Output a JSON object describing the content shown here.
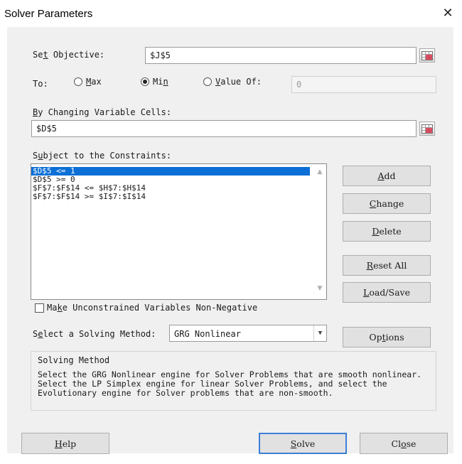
{
  "window": {
    "title": "Solver Parameters",
    "close_glyph": "✕"
  },
  "objective": {
    "label_pre": "Se",
    "label_key": "t",
    "label_post": " Objective:",
    "value": "$J$5"
  },
  "to": {
    "label": "To:",
    "max": {
      "key": "M",
      "rest": "ax",
      "selected": false
    },
    "min": {
      "pre": "Mi",
      "key": "n",
      "selected": true
    },
    "value_of": {
      "key": "V",
      "rest": "alue Of:",
      "selected": false
    },
    "value_field": "0"
  },
  "changing": {
    "label_key": "B",
    "label_rest": "y Changing Variable Cells:",
    "value": "$D$5"
  },
  "constraints": {
    "label_pre": "S",
    "label_key": "u",
    "label_post": "bject to the Constraints:",
    "items": [
      "$D$5 <= 1",
      "$D$5 >= 0",
      "$F$7:$F$14 <= $H$7:$H$14",
      "$F$7:$F$14 >= $I$7:$I$14"
    ],
    "selected_index": 0
  },
  "side_buttons": {
    "add": {
      "key": "A",
      "rest": "dd"
    },
    "change": {
      "key": "C",
      "rest": "hange"
    },
    "delete": {
      "key": "D",
      "rest": "elete"
    },
    "reset_all": {
      "key": "R",
      "rest": "eset All"
    },
    "load_save": {
      "key": "L",
      "rest": "oad/Save"
    }
  },
  "nonneg": {
    "pre": "Ma",
    "key": "k",
    "rest": "e Unconstrained Variables Non-Negative",
    "checked": false
  },
  "method": {
    "label_pre": "S",
    "label_key": "e",
    "label_post": "lect a Solving Method:",
    "selected": "GRG Nonlinear"
  },
  "options_button": {
    "pre": "Op",
    "key": "t",
    "rest": "ions"
  },
  "solving_method": {
    "title": "Solving Method",
    "description": "Select the GRG Nonlinear engine for Solver Problems that are smooth nonlinear.\nSelect the LP Simplex engine for linear Solver Problems, and select the\nEvolutionary engine for Solver problems that are non-smooth."
  },
  "footer": {
    "help": {
      "key": "H",
      "rest": "elp"
    },
    "solve": {
      "key": "S",
      "rest": "olve"
    },
    "close": {
      "pre": "Cl",
      "key": "o",
      "rest": "se"
    }
  },
  "icons": {
    "ref_button": "range-select-icon",
    "dropdown": "chevron-down-icon"
  },
  "colors": {
    "selection": "#0b6fd6",
    "default_button_border": "#3d7ed8",
    "dialog_bg": "#f0f0f0"
  }
}
